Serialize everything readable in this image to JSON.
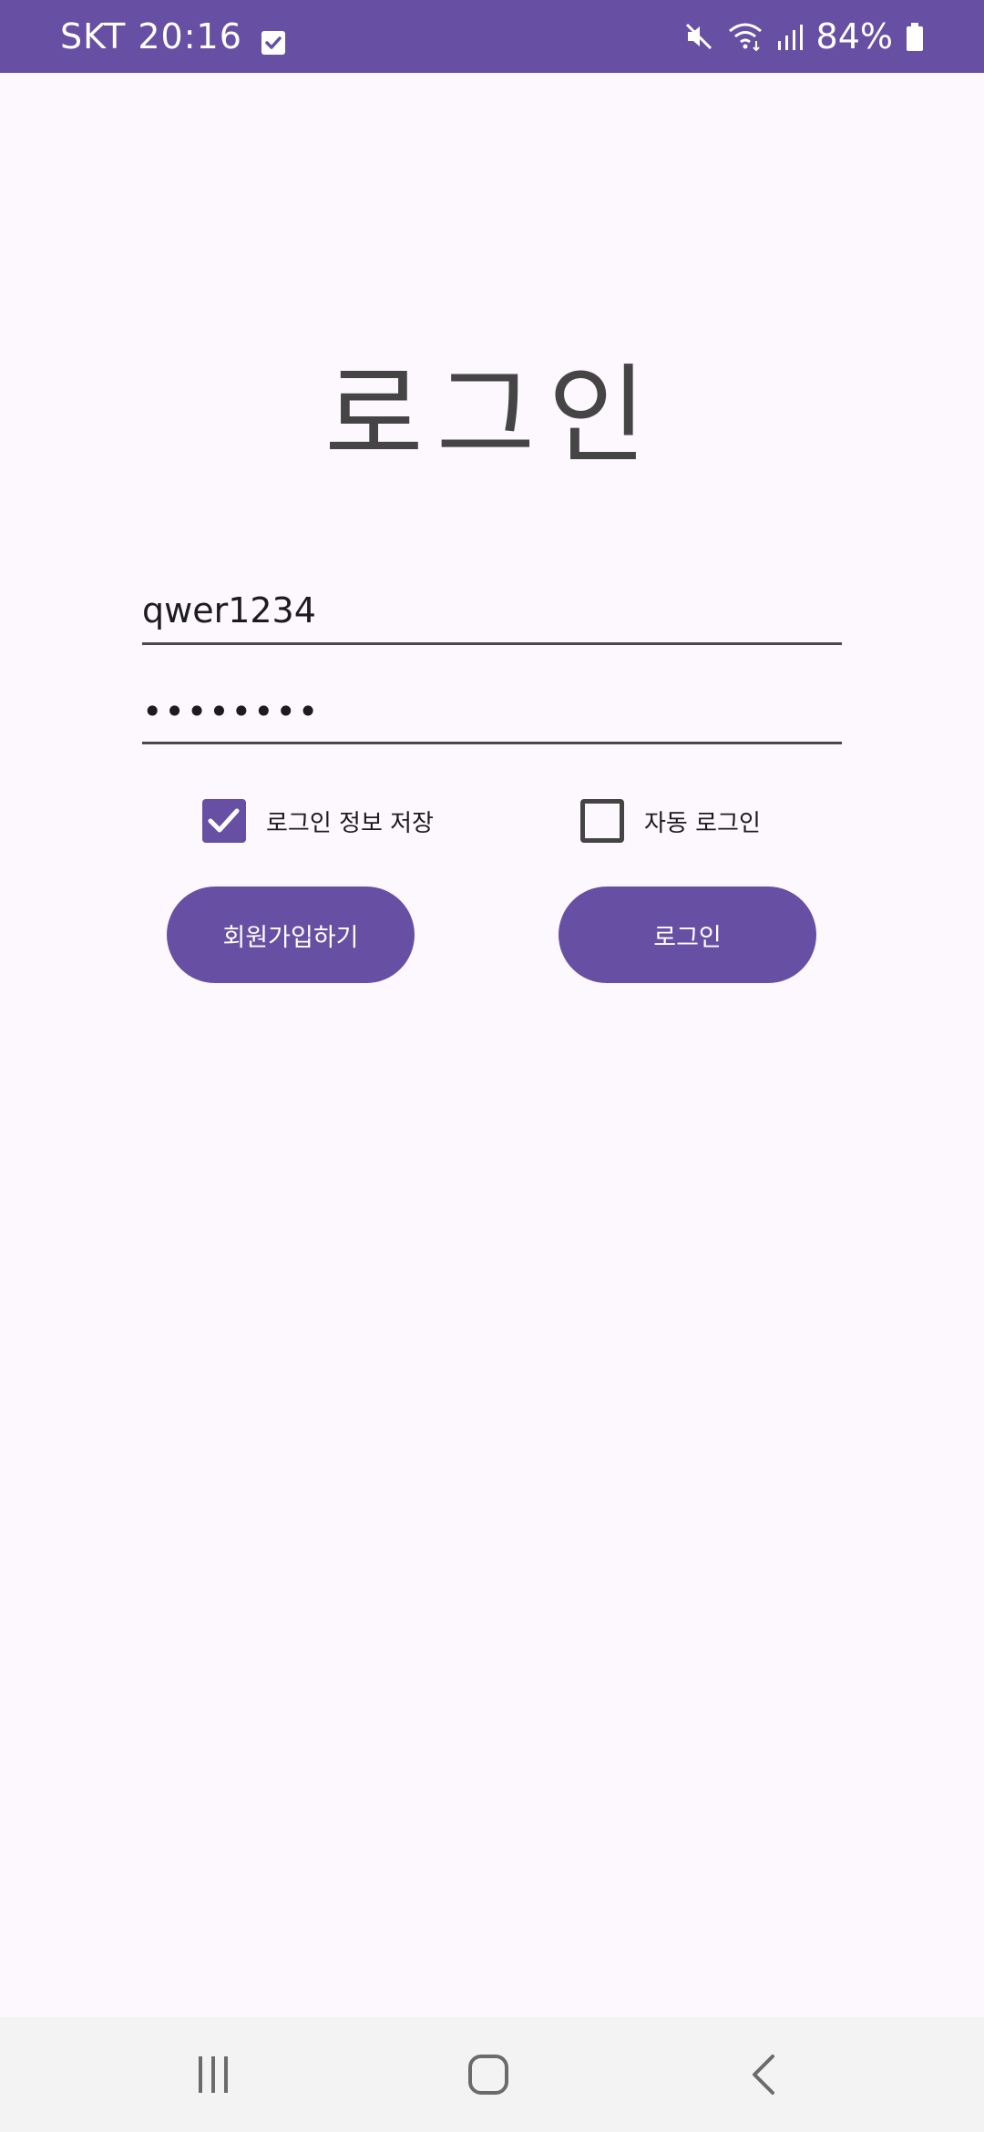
{
  "status_bar": {
    "carrier_time": "SKT 20:16",
    "battery": "84%",
    "icons": [
      "check-box-icon",
      "mute-icon",
      "wifi-icon",
      "signal-icon",
      "battery-icon"
    ]
  },
  "login": {
    "title": "로그인",
    "username_value": "qwer1234",
    "password_value": "••••••••",
    "save_login_label": "로그인 정보 저장",
    "save_login_checked": true,
    "auto_login_label": "자동 로그인",
    "auto_login_checked": false,
    "signup_button": "회원가입하기",
    "login_button": "로그인"
  },
  "nav_bar": {
    "icons": [
      "recents-icon",
      "home-icon",
      "back-icon"
    ]
  },
  "colors": {
    "accent": "#6750a4",
    "background": "#fdf8fd",
    "title_text": "#454545"
  }
}
